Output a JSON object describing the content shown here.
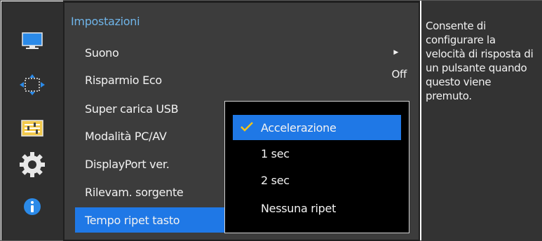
{
  "sidebar": {
    "icons": [
      {
        "name": "monitor-icon",
        "color": "#2b8ae8"
      },
      {
        "name": "position-arrows-icon",
        "color": "#2b8ae8"
      },
      {
        "name": "settings-panel-icon",
        "color": "#f2c94c"
      },
      {
        "name": "gear-icon",
        "color": "#e8e8e8"
      },
      {
        "name": "info-icon",
        "color": "#2b8ae8"
      }
    ]
  },
  "menu": {
    "title": "Impostazioni",
    "items": [
      {
        "label": "Suono",
        "value": "",
        "has_arrow": true
      },
      {
        "label": "Risparmio Eco",
        "value": "Off"
      },
      {
        "label": "Super carica USB",
        "value": ""
      },
      {
        "label": "Modalità PC/AV",
        "value": ""
      },
      {
        "label": "DisplayPort ver.",
        "value": ""
      },
      {
        "label": "Rilevam. sorgente",
        "value": ""
      },
      {
        "label": "Tempo ripet tasto",
        "value": "",
        "selected": true
      }
    ]
  },
  "popup": {
    "options": [
      {
        "label": "Accelerazione",
        "checked": true
      },
      {
        "label": "1 sec",
        "checked": false
      },
      {
        "label": "2 sec",
        "checked": false
      },
      {
        "label": "Nessuna ripet",
        "checked": false
      }
    ]
  },
  "help": {
    "text": "Consente di configurare la velocità di risposta di un pulsante quando questo viene premuto."
  },
  "colors": {
    "accent": "#1f78e6",
    "title": "#6fb4e8",
    "check": "#f5c518"
  }
}
